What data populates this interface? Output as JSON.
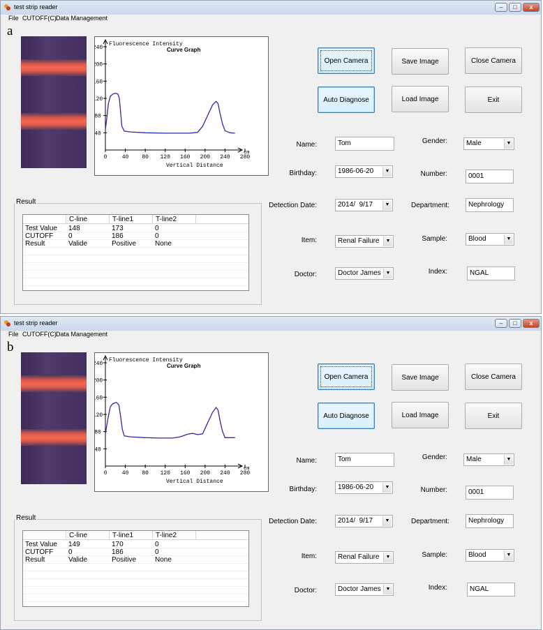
{
  "window_title": "test strip reader",
  "menu": [
    "File",
    "CUTOFF(C)",
    "Data Management"
  ],
  "window_controls": {
    "minimize": "–",
    "maximize": "□",
    "close": "x"
  },
  "graph": {
    "y_axis_label": "Fluorescence Intensity",
    "title": "Curve Graph",
    "x_axis_label": "Vertical Distance",
    "x_unit": "cm",
    "y_ticks": [
      "240",
      "200",
      "160",
      "120",
      "80",
      "40"
    ],
    "x_ticks": [
      "0",
      "40",
      "80",
      "120",
      "160",
      "200",
      "240",
      "280"
    ]
  },
  "buttons": {
    "open_camera": "Open Camera",
    "save_image": "Save Image",
    "close_camera": "Close Camera",
    "auto_diagnose": "Auto Diagnose",
    "load_image": "Load Image",
    "exit": "Exit"
  },
  "form": {
    "name_label": "Name:",
    "name": "Tom",
    "gender_label": "Gender:",
    "gender": "Male",
    "birthday_label": "Birthday:",
    "birthday": "1986-06-20",
    "number_label": "Number:",
    "number": "0001",
    "detection_date_label": "Detection Date:",
    "detection_date": "2014/  9/17",
    "department_label": "Department:",
    "department": "Nephrology",
    "item_label": "Item:",
    "item": "Renal Failure",
    "sample_label": "Sample:",
    "sample": "Blood",
    "doctor_label": "Doctor:",
    "doctor": "Doctor James",
    "index_label": "Index:",
    "index": "NGAL"
  },
  "result_title": "Result",
  "result_columns": [
    "",
    "C-line",
    "T-line1",
    "T-line2"
  ],
  "panels": [
    {
      "letter": "a",
      "rows": [
        {
          "label": "Test Value",
          "c": "148",
          "t1": "173",
          "t2": "0"
        },
        {
          "label": "CUTOFF",
          "c": "0",
          "t1": "186",
          "t2": "0"
        },
        {
          "label": "Result",
          "c": "Valide",
          "t1": "Positive",
          "t2": "None"
        }
      ],
      "curve": [
        [
          0,
          47
        ],
        [
          3,
          75
        ],
        [
          6,
          108
        ],
        [
          10,
          125
        ],
        [
          15,
          130
        ],
        [
          20,
          132
        ],
        [
          25,
          130
        ],
        [
          28,
          120
        ],
        [
          30,
          95
        ],
        [
          33,
          55
        ],
        [
          38,
          44
        ],
        [
          50,
          42
        ],
        [
          80,
          40
        ],
        [
          120,
          39
        ],
        [
          150,
          39
        ],
        [
          170,
          39
        ],
        [
          185,
          41
        ],
        [
          195,
          55
        ],
        [
          205,
          80
        ],
        [
          215,
          105
        ],
        [
          222,
          113
        ],
        [
          226,
          108
        ],
        [
          230,
          85
        ],
        [
          235,
          60
        ],
        [
          240,
          45
        ],
        [
          250,
          40
        ],
        [
          260,
          39
        ]
      ]
    },
    {
      "letter": "b",
      "rows": [
        {
          "label": "Test Value",
          "c": "149",
          "t1": "170",
          "t2": "0"
        },
        {
          "label": "CUTOFF",
          "c": "0",
          "t1": "186",
          "t2": "0"
        },
        {
          "label": "Result",
          "c": "Valide",
          "t1": "Positive",
          "t2": "None"
        }
      ],
      "curve": [
        [
          0,
          75
        ],
        [
          5,
          110
        ],
        [
          10,
          138
        ],
        [
          15,
          145
        ],
        [
          22,
          148
        ],
        [
          27,
          142
        ],
        [
          30,
          120
        ],
        [
          34,
          85
        ],
        [
          38,
          70
        ],
        [
          50,
          68
        ],
        [
          80,
          66
        ],
        [
          110,
          65
        ],
        [
          135,
          65
        ],
        [
          150,
          68
        ],
        [
          165,
          74
        ],
        [
          175,
          76
        ],
        [
          185,
          73
        ],
        [
          195,
          75
        ],
        [
          205,
          100
        ],
        [
          215,
          125
        ],
        [
          222,
          136
        ],
        [
          226,
          130
        ],
        [
          230,
          105
        ],
        [
          235,
          80
        ],
        [
          240,
          66
        ],
        [
          260,
          66
        ]
      ]
    }
  ]
}
